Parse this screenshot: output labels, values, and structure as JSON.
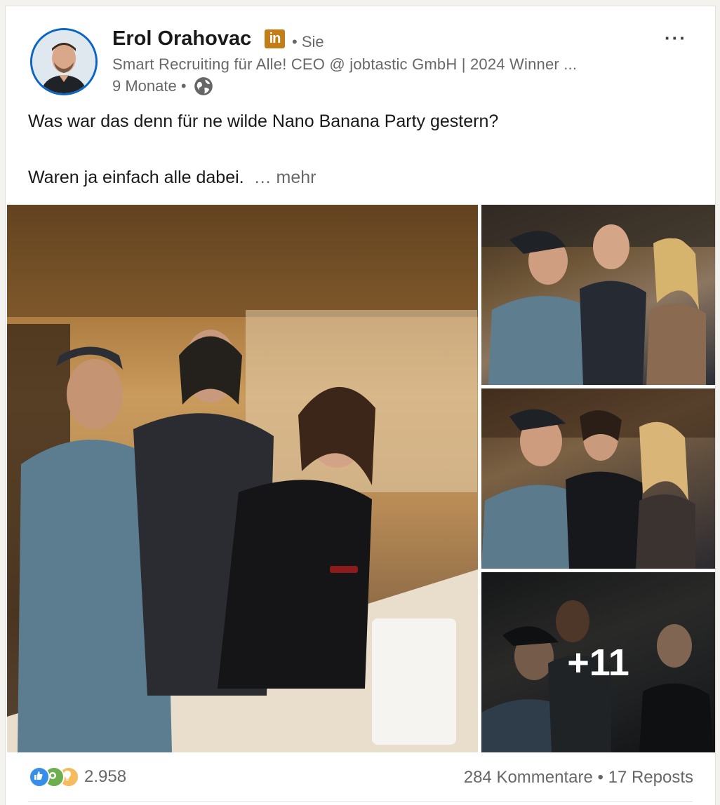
{
  "author": {
    "name": "Erol Orahovac",
    "badge": "in",
    "relation": "• Sie",
    "headline": "Smart Recruiting für Alle! CEO @ jobtastic GmbH | 2024 Winner ...",
    "time": "9 Monate •",
    "visibility_icon": "globe-icon"
  },
  "menu": {
    "more_label": "···"
  },
  "post": {
    "line1": "Was war das denn für ne wilde Nano Banana Party gestern?",
    "line2": "Waren ja einfach alle dabei.",
    "see_more": "… mehr"
  },
  "media": {
    "extra_count": "+11"
  },
  "social": {
    "reaction_icons": [
      "like-icon",
      "celebrate-icon",
      "insight-icon"
    ],
    "reaction_count": "2.958",
    "comments": "284 Kommentare",
    "separator": "•",
    "reposts": "17 Reposts"
  },
  "colors": {
    "accent": "#0a66c2",
    "premium_badge": "#c37d16",
    "secondary_text": "#666666"
  }
}
